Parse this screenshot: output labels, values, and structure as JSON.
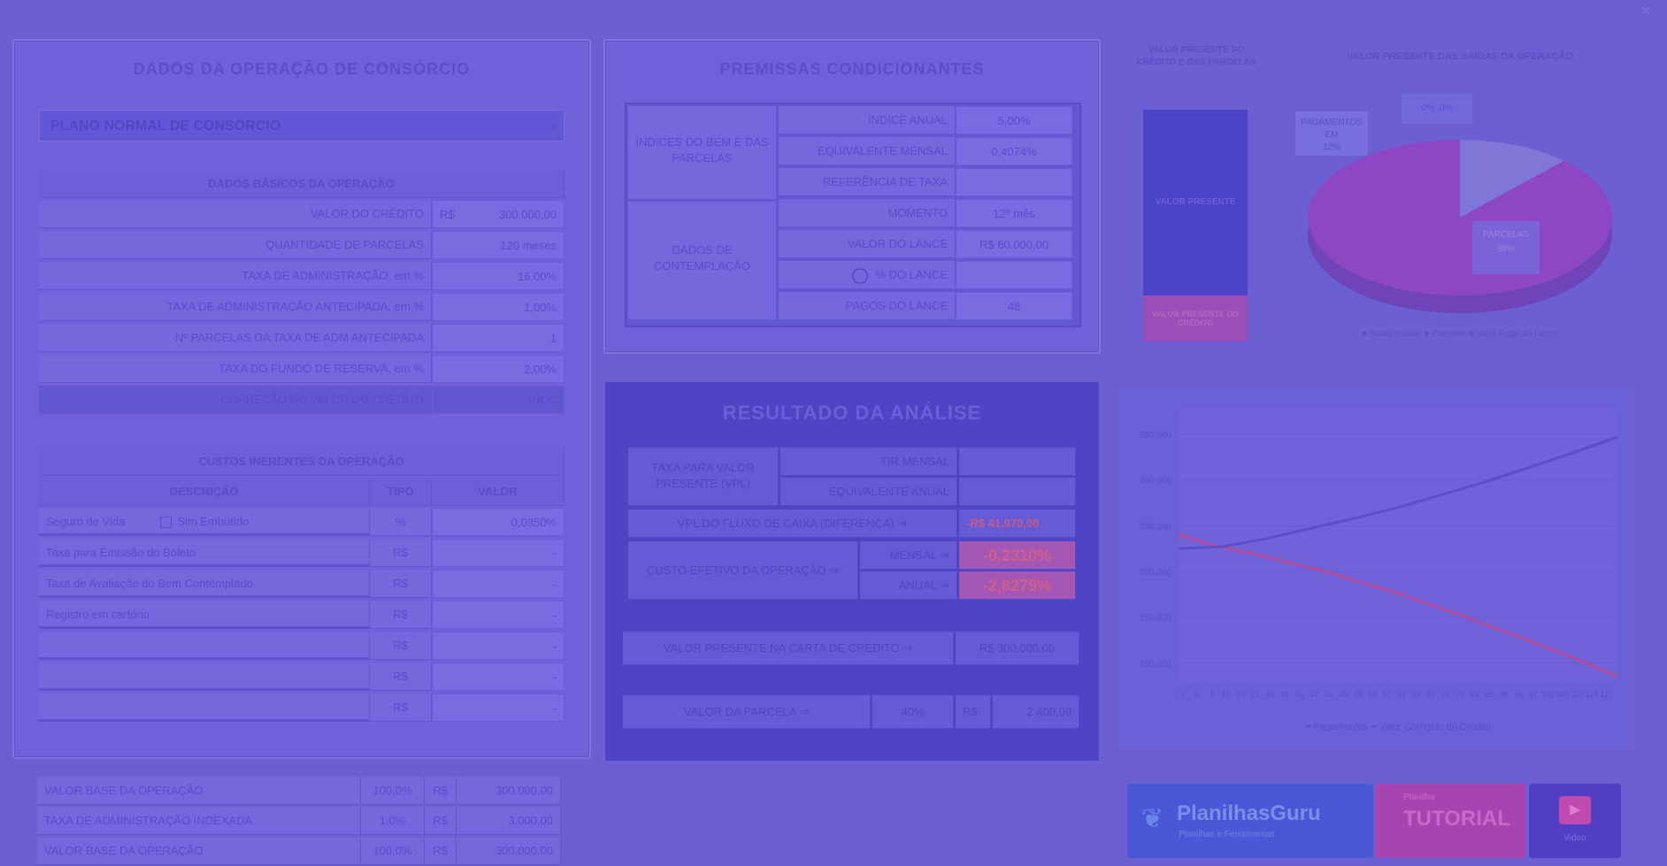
{
  "window": {
    "close_icon": "close-icon"
  },
  "left_panel": {
    "title": "DADOS DA OPERAÇÃO DE CONSÓRCIO",
    "plan_select": "PLANO NORMAL DE CONSÓRCIO",
    "basic_header": "DADOS BÁSICOS DA OPERAÇÃO",
    "basic_rows": [
      {
        "label": "VALOR DO CRÉDITO",
        "prefix": "R$",
        "value": "300.000,00"
      },
      {
        "label": "QUANTIDADE DE PARCELAS",
        "prefix": "",
        "value": "120 meses"
      },
      {
        "label": "TAXA DE ADMINISTRAÇÃO, em %",
        "prefix": "",
        "value": "16,00%"
      },
      {
        "label": "TAXA DE ADMINISTRAÇÃO ANTECIPADA, em %",
        "prefix": "",
        "value": "1,00%"
      },
      {
        "label": "Nº PARCELAS DA TAXA DE ADM ANTECIPADA",
        "prefix": "",
        "value": "1"
      },
      {
        "label": "TAXA DO FUNDO DE RESERVA, em %",
        "prefix": "",
        "value": "2,00%"
      },
      {
        "label": "CORREÇÃO DO VALOR DO CRÉDITO",
        "prefix": "",
        "value": "INCC"
      }
    ],
    "costs_header": "CUSTOS INERENTES DA OPERAÇÃO",
    "costs_cols": [
      "DESCRIÇÃO",
      "TIPO",
      "VALOR"
    ],
    "costs_rows": [
      {
        "desc": "Seguro de Vida",
        "check": "Sim Embutido",
        "tipo": "%",
        "valor": "0,0350%"
      },
      {
        "desc": "Taxa para Emissão do Boleto",
        "check": "",
        "tipo": "R$",
        "valor": "-"
      },
      {
        "desc": "Taxa de Avaliação do Bem Contemplado",
        "check": "",
        "tipo": "R$",
        "valor": "-"
      },
      {
        "desc": "Registro em cartório",
        "check": "",
        "tipo": "R$",
        "valor": "-"
      },
      {
        "desc": "",
        "check": "",
        "tipo": "R$",
        "valor": "-"
      },
      {
        "desc": "",
        "check": "",
        "tipo": "R$",
        "valor": "-"
      },
      {
        "desc": "",
        "check": "",
        "tipo": "R$",
        "valor": "-"
      }
    ],
    "footer_rows": [
      {
        "label": "VALOR BASE DA OPERAÇÃO",
        "pct": "100,0%",
        "cur": "R$",
        "val": "300.000,00"
      },
      {
        "label": "TAXA DE ADMINISTRAÇÃO INDEXADA",
        "pct": "1,0%",
        "cur": "R$",
        "val": "3.000,00"
      },
      {
        "label": "VALOR BASE DA OPERAÇÃO",
        "pct": "100,0%",
        "cur": "R$",
        "val": "300.000,00"
      }
    ]
  },
  "premissas": {
    "title": "PREMISSAS CONDICIONANTES",
    "group1": "ÍNDICES DO BEM E DAS PARCELAS",
    "group2": "DADOS DE CONTEMPLAÇÃO",
    "rows": [
      {
        "label": "ÍNDICE ANUAL",
        "value": "5,00%"
      },
      {
        "label": "EQUIVALENTE MENSAL",
        "value": "0,4074%"
      },
      {
        "label": "REFERÊNCIA DE TAXA",
        "value": ""
      },
      {
        "label": "MOMENTO",
        "value": "12º mês"
      },
      {
        "label": "VALOR DO LANCE",
        "value": "R$ 60.000,00"
      },
      {
        "label": "% DO LANCE",
        "value": ""
      },
      {
        "label": "PAGOS DO LANCE",
        "value": "48"
      }
    ]
  },
  "result": {
    "title": "RESULTADO DA ANÁLISE",
    "group1": "TAXA PARA VALOR PRESENTE (VPL)",
    "tir_label": "TIR MENSAL",
    "tir_value": "",
    "eq_label": "EQUIVALENTE ANUAL",
    "eq_value": "",
    "vpl_label": "VPL DO FLUXO DE CAIXA (DIFERENÇA) ⇒",
    "vpl_value": "-R$ 41.970,00",
    "custo_label": "CUSTO EFETIVO DA OPERAÇÃO ⇒",
    "mensal_label": "MENSAL ⇒",
    "mensal_value": "-0,2310%",
    "anual_label": "ANUAL ⇒",
    "anual_value": "-2,8279%",
    "presente_label": "VALOR PRESENTE NA CARTA DE CRÉDITO ⇒",
    "presente_value": "R$ 300.000,00",
    "parcela_label": "VALOR DA PARCELA ⇒",
    "parcela_pct": "40%",
    "parcela_cur": "R$",
    "parcela_value": "2.400,00"
  },
  "bar_chart": {
    "title": "VALOR PRESENTE DO CRÉDITO E DAS PARCELAS",
    "top_label": "VALOR PRESENTE",
    "bottom_label": "VALOR PRESENTE DO CRÉDITO",
    "top_share": 0.8,
    "bottom_share": 0.2,
    "top_color": "#4b44c8",
    "bottom_color": "#9a4fb8"
  },
  "pie_chart": {
    "title": "VALOR PRESENTE DAS SAÍDAS DA OPERAÇÃO",
    "label_small": "PAGAMENTOS EM",
    "label_small_val": "12%",
    "label_small2": "0%",
    "label_small3": "0%",
    "label_big": "PARCELAS",
    "label_big_val": "88%",
    "legend": "■ Taxas Iniciais   ■ Parcelas   ■ Valor Pago do Lance",
    "slices": [
      0.12,
      0.88
    ],
    "colors": [
      "#7f76d6",
      "#8e47c4"
    ]
  },
  "chart_data": {
    "type": "line",
    "title": "",
    "xlabel": "",
    "ylabel": "",
    "y_ticks": [
      "350.000",
      "300.000",
      "250.000",
      "200.000",
      "150.000",
      "100.000"
    ],
    "x_ticks": [
      "1",
      "5",
      "9",
      "13",
      "17",
      "21",
      "25",
      "29",
      "33",
      "37",
      "41",
      "45",
      "49",
      "53",
      "57",
      "61",
      "65",
      "69",
      "73",
      "77",
      "81",
      "85",
      "89",
      "93",
      "97",
      "101",
      "105",
      "109",
      "113",
      "117"
    ],
    "ylim": [
      80000,
      380000
    ],
    "xlim": [
      0,
      120
    ],
    "series": [
      {
        "name": "Pagamentos",
        "color": "#b24a9c",
        "x": [
          0,
          10,
          20,
          30,
          40,
          50,
          60,
          70,
          80,
          90,
          100,
          110,
          120
        ],
        "y": [
          240000,
          228000,
          220000,
          210000,
          200000,
          188000,
          176000,
          162000,
          148000,
          133000,
          118000,
          102000,
          85000
        ]
      },
      {
        "name": "Valor Corrigido do Crédito",
        "color": "#5a4fc9",
        "x": [
          0,
          12,
          24,
          36,
          48,
          60,
          72,
          84,
          96,
          108,
          120
        ],
        "y": [
          225000,
          227000,
          236000,
          247000,
          258000,
          270000,
          284000,
          298000,
          314000,
          330000,
          347000
        ]
      }
    ],
    "legend": [
      "Pagamentos",
      "Valor Corrigido do Crédito"
    ]
  },
  "ads": {
    "ad1_title": "PlanilhasGuru",
    "ad1_sub": "Planilhas e Ferramentas",
    "ad2_title": "TUTORIAL",
    "ad2_sub": "Planilha",
    "ad3_label": "Video"
  }
}
